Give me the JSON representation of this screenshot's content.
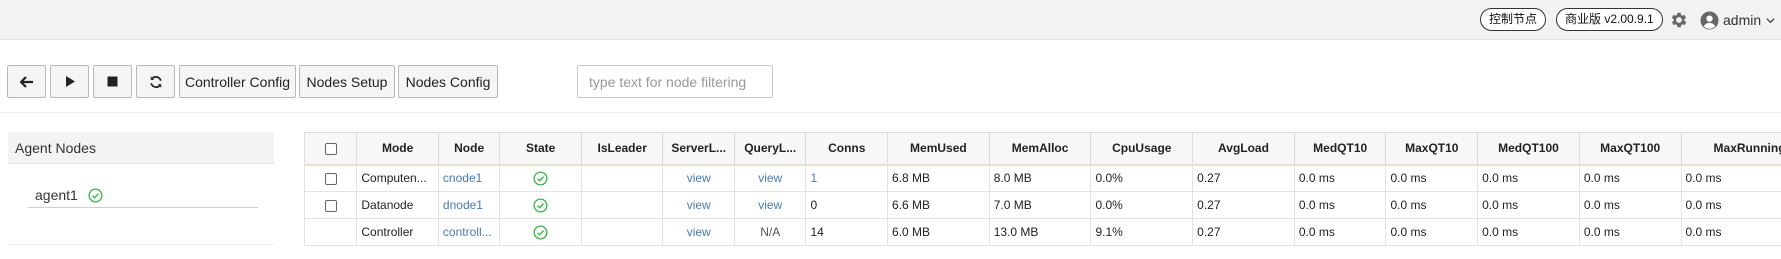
{
  "header": {
    "control_node_label": "控制节点",
    "version_label": "商业版 v2.00.9.1",
    "settings_icon": "gear-icon",
    "user": {
      "icon": "user-circle-icon",
      "name": "admin",
      "caret_icon": "chevron-down-icon"
    }
  },
  "toolbar": {
    "back_icon": "arrow-left-icon",
    "play_icon": "play-icon",
    "stop_icon": "stop-icon",
    "refresh_icon": "refresh-icon",
    "controller_config_label": "Controller Config",
    "nodes_setup_label": "Nodes Setup",
    "nodes_config_label": "Nodes Config",
    "filter_placeholder": "type text for node filtering"
  },
  "agent_panel": {
    "title": "Agent Nodes",
    "agents": [
      {
        "name": "agent1",
        "status_icon": "check-circle-icon"
      }
    ]
  },
  "table": {
    "columns": [
      "",
      "Mode",
      "Node",
      "State",
      "IsLeader",
      "ServerL...",
      "QueryL...",
      "Conns",
      "MemUsed",
      "MemAlloc",
      "CpuUsage",
      "AvgLoad",
      "MedQT10",
      "MaxQT10",
      "MedQT100",
      "MaxQT100",
      "MaxRunningQ"
    ],
    "rows": [
      {
        "checkbox": true,
        "mode": "Computen...",
        "node": "cnode1",
        "state_icon": "check-circle-icon",
        "is_leader": "",
        "server_log": "view",
        "query_log": "view",
        "conns": "1",
        "mem_used": "6.8 MB",
        "mem_alloc": "8.0 MB",
        "cpu_usage": "0.0%",
        "avg_load": "0.27",
        "med_qt10": "0.0 ms",
        "max_qt10": "0.0 ms",
        "med_qt100": "0.0 ms",
        "max_qt100": "0.0 ms",
        "max_running_q": "0.0 ms"
      },
      {
        "checkbox": true,
        "mode": "Datanode",
        "node": "dnode1",
        "state_icon": "check-circle-icon",
        "is_leader": "",
        "server_log": "view",
        "query_log": "view",
        "conns": "0",
        "mem_used": "6.6 MB",
        "mem_alloc": "7.0 MB",
        "cpu_usage": "0.0%",
        "avg_load": "0.27",
        "med_qt10": "0.0 ms",
        "max_qt10": "0.0 ms",
        "med_qt100": "0.0 ms",
        "max_qt100": "0.0 ms",
        "max_running_q": "0.0 ms"
      },
      {
        "checkbox": false,
        "mode": "Controller",
        "node": "controll...",
        "state_icon": "check-circle-icon",
        "is_leader": "",
        "server_log": "view",
        "query_log": "N/A",
        "conns": "14",
        "mem_used": "6.0 MB",
        "mem_alloc": "13.0 MB",
        "cpu_usage": "9.1%",
        "avg_load": "0.27",
        "med_qt10": "0.0 ms",
        "max_qt10": "0.0 ms",
        "med_qt100": "0.0 ms",
        "max_qt100": "0.0 ms",
        "max_running_q": "0.0 ms"
      }
    ]
  },
  "colors": {
    "link": "#4a7ab5",
    "ok_green": "#3bb54a"
  }
}
